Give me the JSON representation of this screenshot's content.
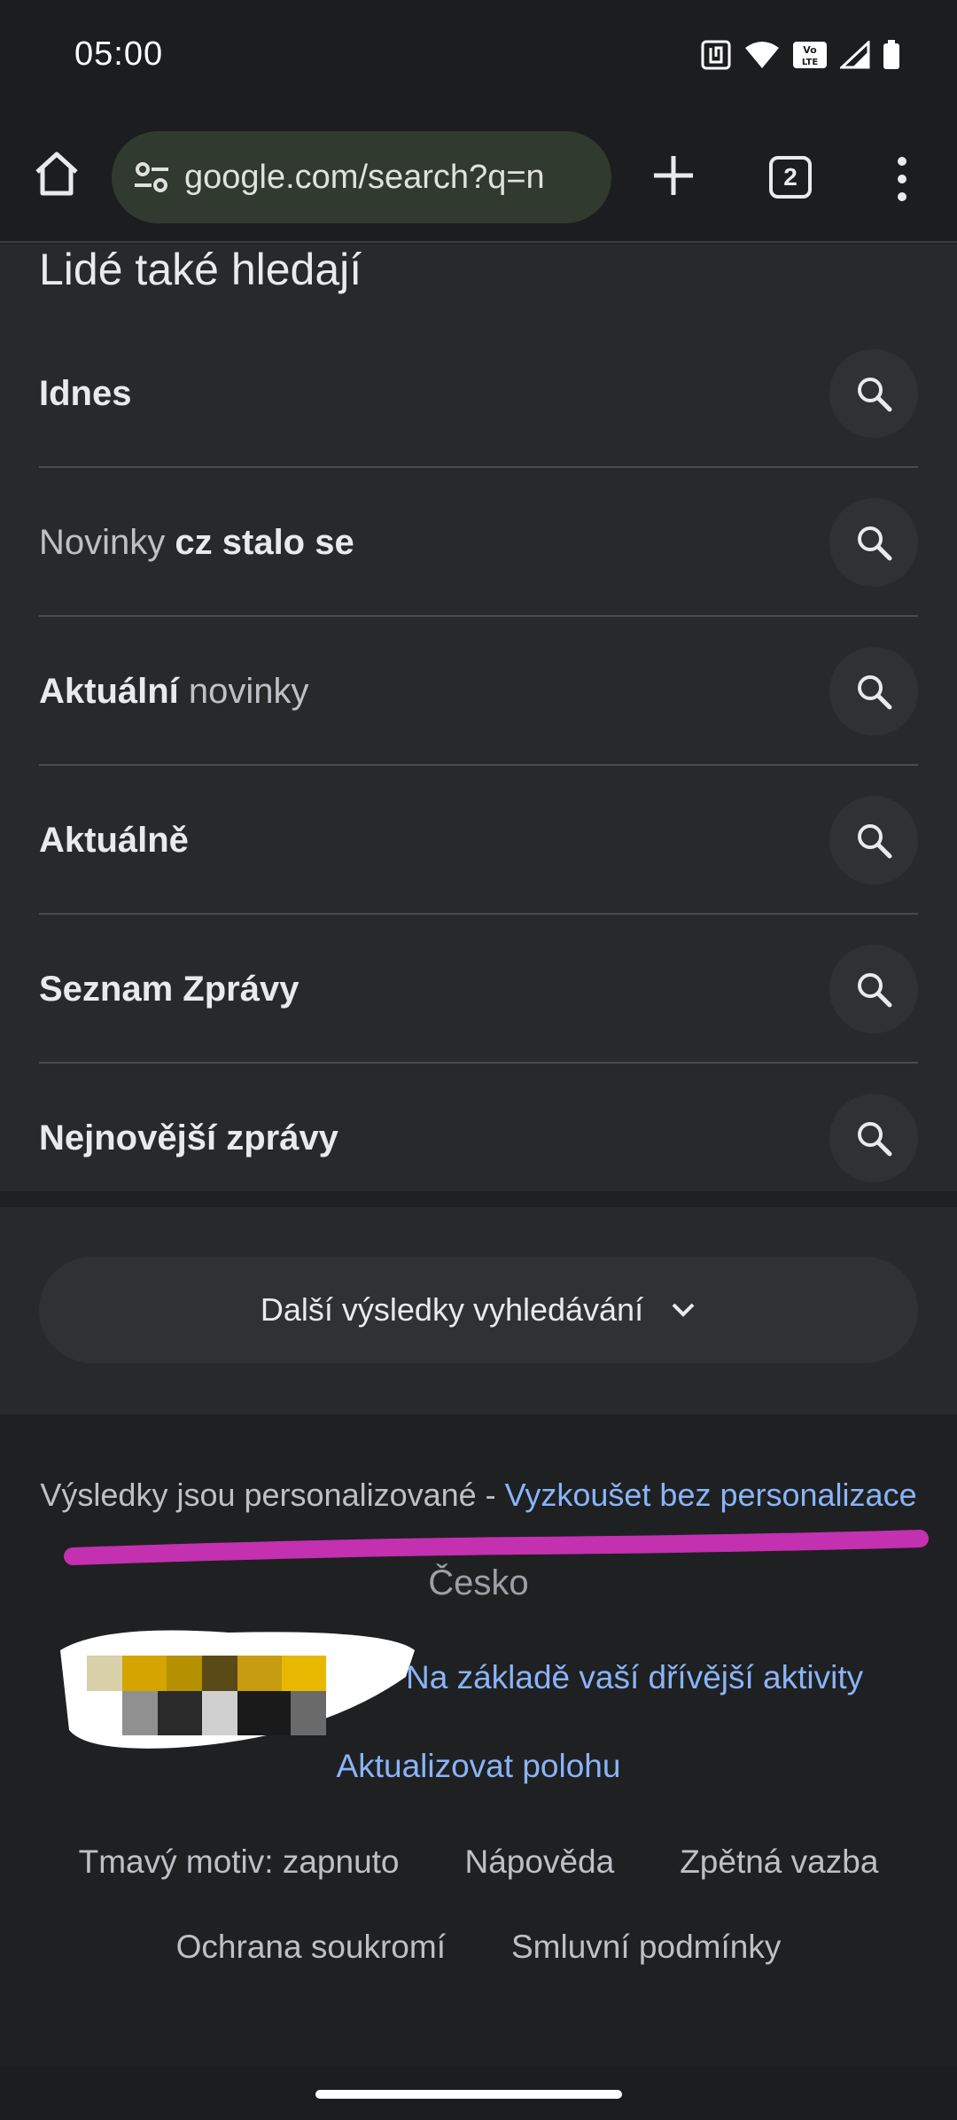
{
  "status_bar": {
    "time": "05:00",
    "icons": [
      "nfc-icon",
      "wifi-icon",
      "volte-icon",
      "signal-icon",
      "battery-icon"
    ]
  },
  "toolbar": {
    "url": "google.com/search?q=n",
    "tab_count": "2"
  },
  "related_searches": {
    "title": "Lidé také hledají",
    "items": [
      {
        "parts": [
          {
            "text": "Idnes",
            "bold": true
          }
        ]
      },
      {
        "parts": [
          {
            "text": "Novinky ",
            "bold": false
          },
          {
            "text": "cz stalo se",
            "bold": true
          }
        ]
      },
      {
        "parts": [
          {
            "text": "Aktuální",
            "bold": true
          },
          {
            "text": " novinky",
            "bold": false
          }
        ]
      },
      {
        "parts": [
          {
            "text": "Aktuálně",
            "bold": true
          }
        ]
      },
      {
        "parts": [
          {
            "text": "Seznam Zprávy",
            "bold": true
          }
        ]
      },
      {
        "parts": [
          {
            "text": "Nejnovější zprávy",
            "bold": true
          }
        ]
      }
    ]
  },
  "more_results": {
    "label": "Další výsledky vyhledávání"
  },
  "footer": {
    "personalized_text": "Výsledky jsou personalizované - ",
    "personalized_link": "Vyzkoušet bez personalizace",
    "country": "Česko",
    "activity_link": "Na základě vaší dřívější aktivity",
    "update_location": "Aktualizovat polohu",
    "links_row1": [
      "Tmavý motiv: zapnuto",
      "Nápověda",
      "Zpětná vazba"
    ],
    "links_row2": [
      "Ochrana soukromí",
      "Smluvní podmínky"
    ]
  },
  "colors": {
    "background": "#202124",
    "link": "#8ab4f8",
    "annotation_stroke": "#c330b0"
  }
}
